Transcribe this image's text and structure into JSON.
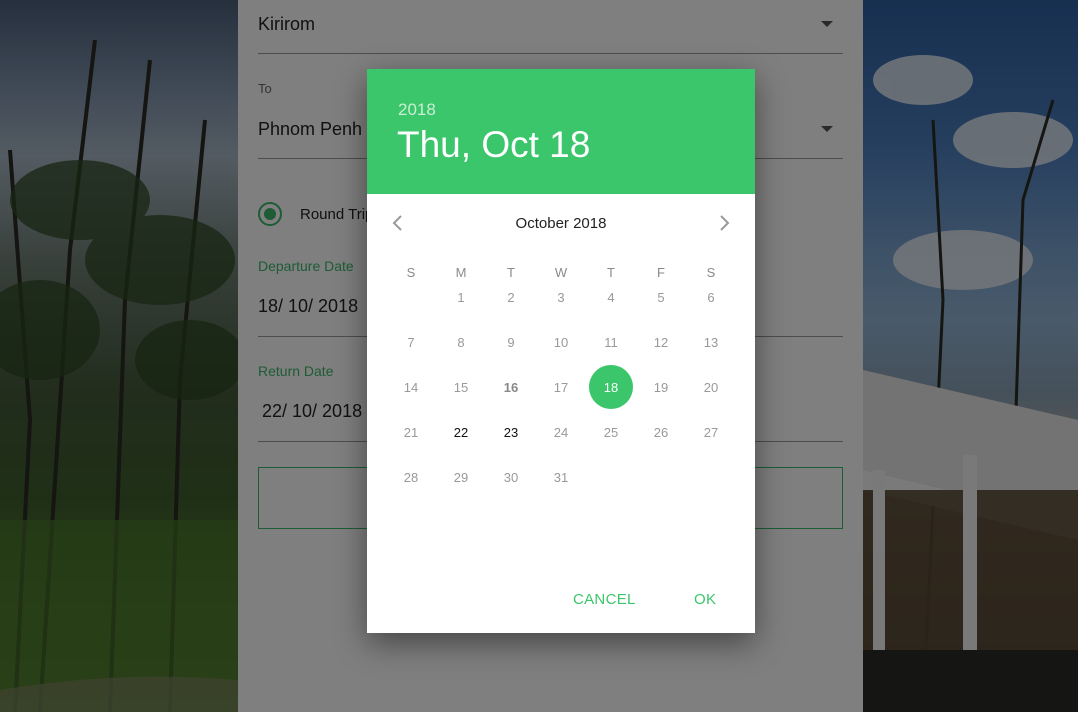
{
  "form": {
    "from_value": "Kirirom",
    "to_label": "To",
    "to_value": "Phnom Penh",
    "trip_type_label": "Round Trip",
    "departure_label": "Departure Date",
    "departure_value": "18/ 10/ 2018",
    "return_label": "Return Date",
    "return_value": "22/ 10/ 2018"
  },
  "datepicker": {
    "header_year": "2018",
    "header_date": "Thu, Oct 18",
    "month_title": "October 2018",
    "weekdays": [
      "S",
      "M",
      "T",
      "W",
      "T",
      "F",
      "S"
    ],
    "first_weekday_offset": 1,
    "days_in_month": 31,
    "selected_day": 18,
    "today_day": 16,
    "range_days": [
      22,
      23
    ],
    "cancel_label": "CANCEL",
    "ok_label": "OK",
    "accent_color": "#3bc66b"
  },
  "icons": {
    "prev": "chevron-left-icon",
    "next": "chevron-right-icon",
    "dropdown": "caret-down-icon"
  }
}
